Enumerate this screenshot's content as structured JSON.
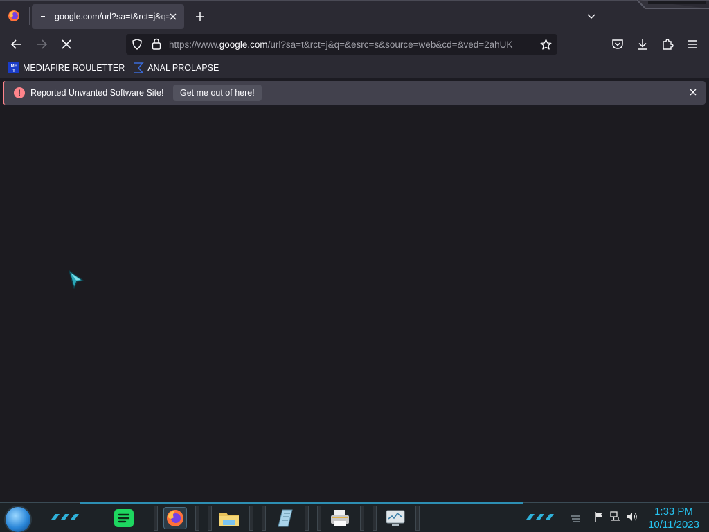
{
  "browser": {
    "tab": {
      "title": "google.com/url?sa=t&rct=j&q="
    },
    "urlbar": {
      "url_prefix": "https://www.",
      "url_host": "google.com",
      "url_rest": "/url?sa=t&rct=j&q=&esrc=s&source=web&cd=&ved=2ahUK"
    },
    "bookmarks": [
      {
        "label": "MEDIAFIRE ROULETTER",
        "icon": "mediafire-icon"
      },
      {
        "label": "ANAL PROLAPSE",
        "icon": "sigma-icon"
      }
    ],
    "notification": {
      "icon": "!",
      "message": "Reported Unwanted Software Site!",
      "action_label": "Get me out of here!"
    }
  },
  "taskbar": {
    "apps": [
      "spotify-icon",
      "firefox-icon",
      "file-explorer-icon",
      "notepad-icon",
      "printer-icon",
      "task-manager-icon"
    ],
    "tray": [
      "action-center-flag-icon",
      "network-icon",
      "volume-icon"
    ],
    "clock": {
      "time": "1:33 PM",
      "date": "10/11/2023"
    }
  },
  "colors": {
    "chrome": "#2b2a33",
    "content": "#1c1b20",
    "warning": "#ff848b",
    "clock": "#26c3f0",
    "taskbar_accent": "#2d8fb3"
  }
}
